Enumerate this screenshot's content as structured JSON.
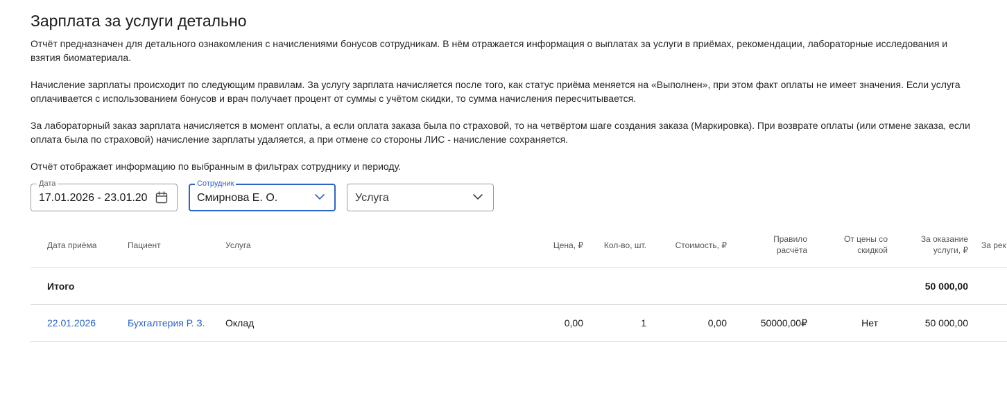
{
  "page": {
    "title": "Зарплата за услуги детально",
    "paragraphs": [
      "Отчёт предназначен для детального ознакомления с начислениями бонусов сотрудникам. В нём отражается информация о выплатах за услуги в приёмах, рекомендации, лабораторные исследования и",
      "взятия биоматериала.",
      "Начисление зарплаты происходит по следующим правилам. За услугу зарплата начисляется после того, как статус приёма меняется на «Выполнен», при этом факт оплаты не имеет значения. Если услуга",
      "оплачивается с использованием бонусов и врач получает процент от суммы с учётом скидки, то сумма начисления пересчитывается.",
      "За лабораторный заказ зарплата начисляется в момент оплаты, а если оплата заказа была по страховой, то на четвёртом шаге создания заказа (Маркировка). При возврате оплаты (или отмене заказа, если",
      "оплата была по страховой) начисление зарплаты удаляется, а при отмене со стороны ЛИС - начисление сохраняется.",
      "Отчёт отображает информацию по выбранным в фильтрах сотруднику и периоду."
    ]
  },
  "filters": {
    "date": {
      "label": "Дата",
      "value": "17.01.2026 - 23.01.20",
      "icon": "calendar-icon"
    },
    "employee": {
      "label": "Сотрудник",
      "value": "Смирнова Е. О.",
      "icon": "chevron-down-icon"
    },
    "service": {
      "placeholder": "Услуга",
      "icon": "chevron-down-icon"
    }
  },
  "table": {
    "columns": {
      "date": "Дата приёма",
      "patient": "Пациент",
      "service": "Услуга",
      "price": "Цена, ₽",
      "qty": "Кол-во, шт.",
      "cost": "Стоимость, ₽",
      "rule_1": "Правило",
      "rule_2": "расчёта",
      "discount_1": "От цены со",
      "discount_2": "скидкой",
      "for_service_1": "За оказание",
      "for_service_2": "услуги, ₽",
      "for_rec": "За рек"
    },
    "total": {
      "label": "Итого",
      "for_service": "50 000,00"
    },
    "rows": [
      {
        "date": "22.01.2026",
        "patient": "Бухгалтерия Р. З.",
        "service": "Оклад",
        "price": "0,00",
        "qty": "1",
        "cost": "0,00",
        "rule": "50000,00₽",
        "discount": "Нет",
        "for_service": "50 000,00"
      }
    ]
  },
  "colors": {
    "accent": "#2b63c6",
    "border": "#dcdcdc"
  }
}
